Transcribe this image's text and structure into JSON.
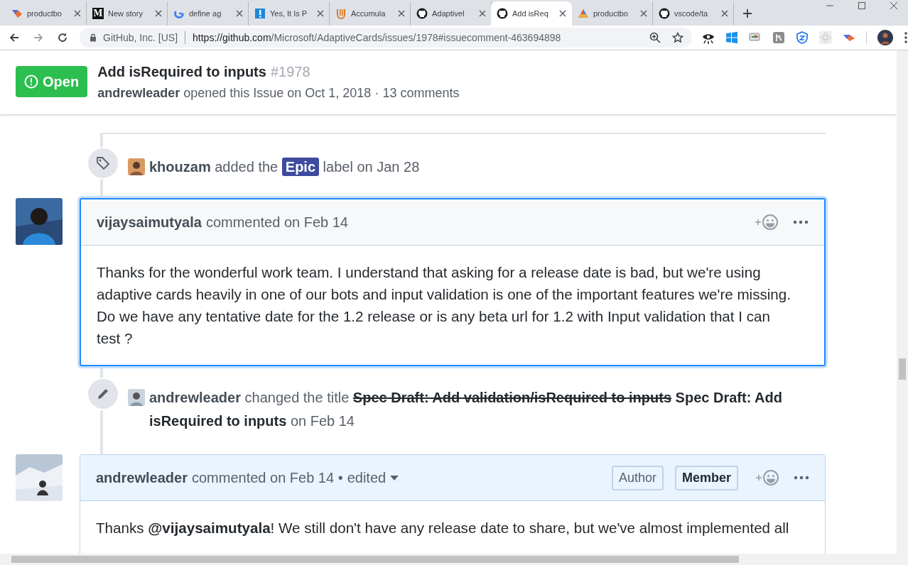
{
  "browser": {
    "tabs": [
      {
        "title": "productbo",
        "kind": "diamond",
        "selected": false
      },
      {
        "title": "New story",
        "kind": "letter",
        "glyph": "M",
        "selected": false
      },
      {
        "title": "define ag",
        "kind": "ring",
        "selected": false
      },
      {
        "title": "Yes, It Is P",
        "kind": "alert",
        "selected": false
      },
      {
        "title": "Accumula",
        "kind": "stripes",
        "selected": false
      },
      {
        "title": "AdaptiveI",
        "kind": "octocat",
        "selected": false
      },
      {
        "title": "Add isReq",
        "kind": "octocat",
        "selected": true
      },
      {
        "title": "productbo",
        "kind": "pyramid",
        "selected": false
      },
      {
        "title": "vscode/ta",
        "kind": "octocat",
        "selected": false
      }
    ],
    "omnibox": {
      "site": "GitHub, Inc. [US]",
      "url_host": "https://github.com",
      "url_path": "/Microsoft/AdaptiveCards/issues/1978#issuecomment-463694898"
    }
  },
  "issue": {
    "state": "Open",
    "title": "Add isRequired to inputs",
    "number": "#1978",
    "author": "andrewleader",
    "meta": "opened this Issue on Oct 1, 2018 · 13 comments"
  },
  "timeline": [
    {
      "kind": "label_event",
      "actor": "khouzam",
      "verb": "added the",
      "label": "Epic",
      "suffix": "label on Jan 28"
    },
    {
      "kind": "comment",
      "author": "vijaysaimutyala",
      "meta": "commented on Feb 14",
      "highlighted": true,
      "by_author": false,
      "body": "Thanks for the wonderful work team. I understand that asking for a release date is bad, but we're using adaptive cards heavily in one of our bots and input validation is one of the important features we're missing. Do we have any tentative date for the 1.2 release or is any beta url for 1.2 with Input validation that I can test ?"
    },
    {
      "kind": "rename_event",
      "actor": "andrewleader",
      "verb": "changed the title",
      "old_title": "Spec Draft: Add validation/isRequired to inputs",
      "new_title": "Spec Draft: Add isRequired to inputs",
      "suffix": "on Feb 14"
    },
    {
      "kind": "comment",
      "author": "andrewleader",
      "meta": "commented on Feb 14 •",
      "edited": "edited",
      "highlighted": false,
      "by_author": true,
      "badges": [
        {
          "text": "Author",
          "strong": false
        },
        {
          "text": "Member",
          "strong": true
        }
      ],
      "body": "Thanks **@vijaysaimutyala**! We still don't have any release date to share, but we've almost implemented all"
    }
  ]
}
